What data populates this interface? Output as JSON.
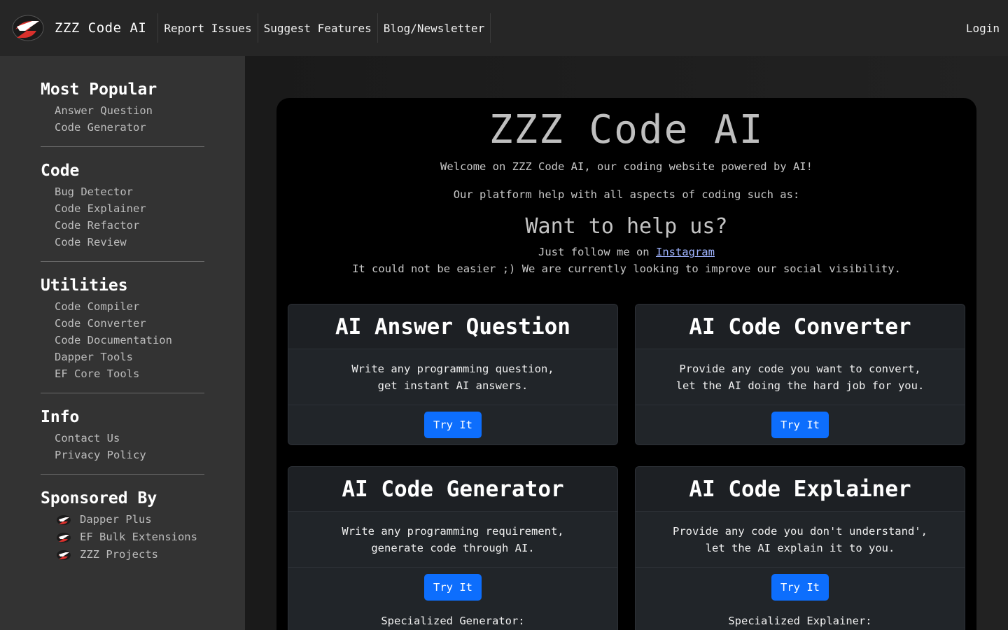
{
  "nav": {
    "brand": "ZZZ Code AI",
    "links": [
      "Report Issues",
      "Suggest Features",
      "Blog/Newsletter"
    ],
    "login": "Login"
  },
  "sidebar": {
    "sections": [
      {
        "title": "Most Popular",
        "items": [
          "Answer Question",
          "Code Generator"
        ]
      },
      {
        "title": "Code",
        "items": [
          "Bug Detector",
          "Code Explainer",
          "Code Refactor",
          "Code Review"
        ]
      },
      {
        "title": "Utilities",
        "items": [
          "Code Compiler",
          "Code Converter",
          "Code Documentation",
          "Dapper Tools",
          "EF Core Tools"
        ]
      },
      {
        "title": "Info",
        "items": [
          "Contact Us",
          "Privacy Policy"
        ]
      }
    ],
    "sponsor": {
      "title": "Sponsored By",
      "items": [
        "Dapper Plus",
        "EF Bulk Extensions",
        "ZZZ Projects"
      ]
    }
  },
  "hero": {
    "title": "ZZZ Code AI",
    "welcome": "Welcome on ZZZ Code AI, our coding website powered by AI!",
    "platform": "Our platform help with all aspects of coding such as:",
    "help_title": "Want to help us?",
    "follow_prefix": "Just follow me on",
    "follow_link": "Instagram",
    "easier": "It could not be easier ;) We are currently looking to improve our social visibility."
  },
  "cards": [
    {
      "title": "AI Answer Question",
      "line1": "Write any programming question,",
      "line2": "get instant AI answers.",
      "button": "Try It"
    },
    {
      "title": "AI Code Converter",
      "line1": "Provide any code you want to convert,",
      "line2": "let the AI doing the hard job for you.",
      "button": "Try It"
    },
    {
      "title": "AI Code Generator",
      "line1": "Write any programming requirement,",
      "line2": "generate code through AI.",
      "button": "Try It",
      "extra": "Specialized Generator:"
    },
    {
      "title": "AI Code Explainer",
      "line1": "Provide any code you don't understand',",
      "line2": "let the AI explain it to you.",
      "button": "Try It",
      "extra": "Specialized Explainer:"
    }
  ],
  "colors": {
    "accent": "#0d6efd",
    "logo_red": "#d9302c"
  }
}
